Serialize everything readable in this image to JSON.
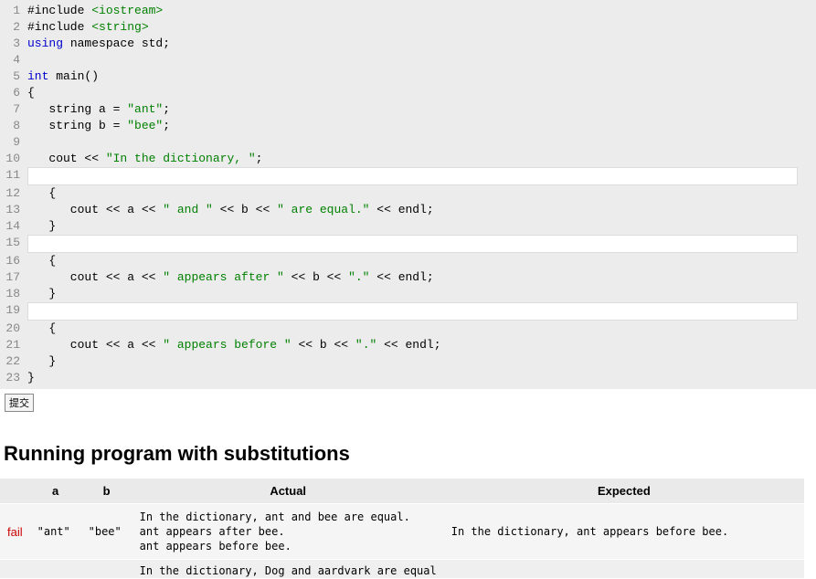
{
  "code": {
    "lines": [
      {
        "n": "1",
        "segs": [
          [
            "#include ",
            ""
          ],
          [
            "<iostream>",
            "include-target"
          ]
        ]
      },
      {
        "n": "2",
        "segs": [
          [
            "#include ",
            ""
          ],
          [
            "<string>",
            "include-target"
          ]
        ]
      },
      {
        "n": "3",
        "segs": [
          [
            "using",
            "type"
          ],
          [
            " namespace std;",
            ""
          ]
        ]
      },
      {
        "n": "4",
        "segs": [
          [
            "",
            ""
          ]
        ]
      },
      {
        "n": "5",
        "segs": [
          [
            "int ",
            "type"
          ],
          [
            "main()",
            ""
          ]
        ]
      },
      {
        "n": "6",
        "segs": [
          [
            "{",
            ""
          ]
        ]
      },
      {
        "n": "7",
        "segs": [
          [
            "   string a = ",
            ""
          ],
          [
            "\"ant\"",
            "string"
          ],
          [
            ";",
            ""
          ]
        ]
      },
      {
        "n": "8",
        "segs": [
          [
            "   string b = ",
            ""
          ],
          [
            "\"bee\"",
            "string"
          ],
          [
            ";",
            ""
          ]
        ]
      },
      {
        "n": "9",
        "segs": [
          [
            "",
            ""
          ]
        ]
      },
      {
        "n": "10",
        "segs": [
          [
            "   cout << ",
            ""
          ],
          [
            "\"In the dictionary, \"",
            "string"
          ],
          [
            ";",
            ""
          ]
        ]
      },
      {
        "n": "11",
        "hilite": true,
        "segs": [
          [
            "   ",
            ""
          ]
        ]
      },
      {
        "n": "12",
        "segs": [
          [
            "   {",
            ""
          ]
        ]
      },
      {
        "n": "13",
        "segs": [
          [
            "      cout << a << ",
            ""
          ],
          [
            "\" and \"",
            "string"
          ],
          [
            " << b << ",
            ""
          ],
          [
            "\" are equal.\"",
            "string"
          ],
          [
            " << endl;",
            ""
          ]
        ]
      },
      {
        "n": "14",
        "segs": [
          [
            "   }",
            ""
          ]
        ]
      },
      {
        "n": "15",
        "hilite": true,
        "segs": [
          [
            "   ",
            ""
          ]
        ]
      },
      {
        "n": "16",
        "segs": [
          [
            "   {",
            ""
          ]
        ]
      },
      {
        "n": "17",
        "segs": [
          [
            "      cout << a << ",
            ""
          ],
          [
            "\" appears after \"",
            "string"
          ],
          [
            " << b << ",
            ""
          ],
          [
            "\".\"",
            "string"
          ],
          [
            " << endl;",
            ""
          ]
        ]
      },
      {
        "n": "18",
        "segs": [
          [
            "   }",
            ""
          ]
        ]
      },
      {
        "n": "19",
        "hilite": true,
        "segs": [
          [
            "   ",
            ""
          ]
        ]
      },
      {
        "n": "20",
        "segs": [
          [
            "   {",
            ""
          ]
        ]
      },
      {
        "n": "21",
        "segs": [
          [
            "      cout << a << ",
            ""
          ],
          [
            "\" appears before \"",
            "string"
          ],
          [
            " << b << ",
            ""
          ],
          [
            "\".\"",
            "string"
          ],
          [
            " << endl;",
            ""
          ]
        ]
      },
      {
        "n": "22",
        "segs": [
          [
            "   }",
            ""
          ]
        ]
      },
      {
        "n": "23",
        "segs": [
          [
            "}",
            ""
          ]
        ]
      }
    ]
  },
  "submit": {
    "label": "提交"
  },
  "results": {
    "title": "Running program with substitutions",
    "headers": {
      "status": "",
      "a": "a",
      "b": "b",
      "actual": "Actual",
      "expected": "Expected"
    },
    "rows": [
      {
        "status": "fail",
        "a": "\"ant\"",
        "b": "\"bee\"",
        "actual": "In the dictionary, ant and bee are equal.\nant appears after bee.\nant appears before bee.",
        "expected": "In the dictionary, ant appears before bee."
      }
    ],
    "partial_actual": "In the dictionary, Dog and aardvark are equal"
  }
}
